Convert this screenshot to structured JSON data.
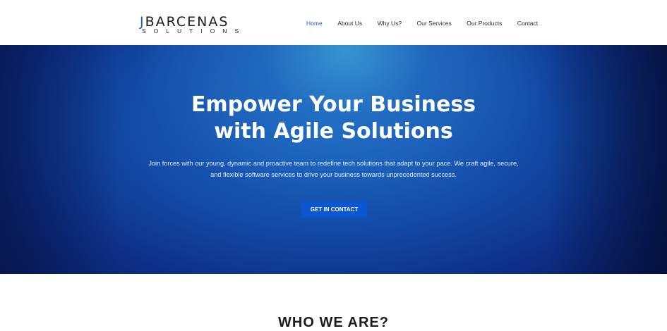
{
  "header": {
    "logo": {
      "letter_j": "J",
      "name": "BARCENAS",
      "tagline": "SOLUTIONS"
    },
    "nav": [
      {
        "label": "Home",
        "active": true
      },
      {
        "label": "About Us",
        "active": false
      },
      {
        "label": "Why Us?",
        "active": false
      },
      {
        "label": "Our Services",
        "active": false
      },
      {
        "label": "Our Products",
        "active": false
      },
      {
        "label": "Contact",
        "active": false
      }
    ]
  },
  "hero": {
    "title_line1": "Empower Your Business",
    "title_line2": "with Agile Solutions",
    "text_line1": "Join forces with our young, dynamic and proactive team to redefine tech solutions that adapt to your pace. We craft agile, secure,",
    "text_line2": "and flexible software services to drive your business towards unprecedented success.",
    "button_label": "GET IN CONTACT"
  },
  "about": {
    "heading": "WHO WE ARE?"
  },
  "colors": {
    "accent": "#1e5fb0",
    "button": "#0a58d1",
    "hero_dark": "#0a1f62"
  }
}
